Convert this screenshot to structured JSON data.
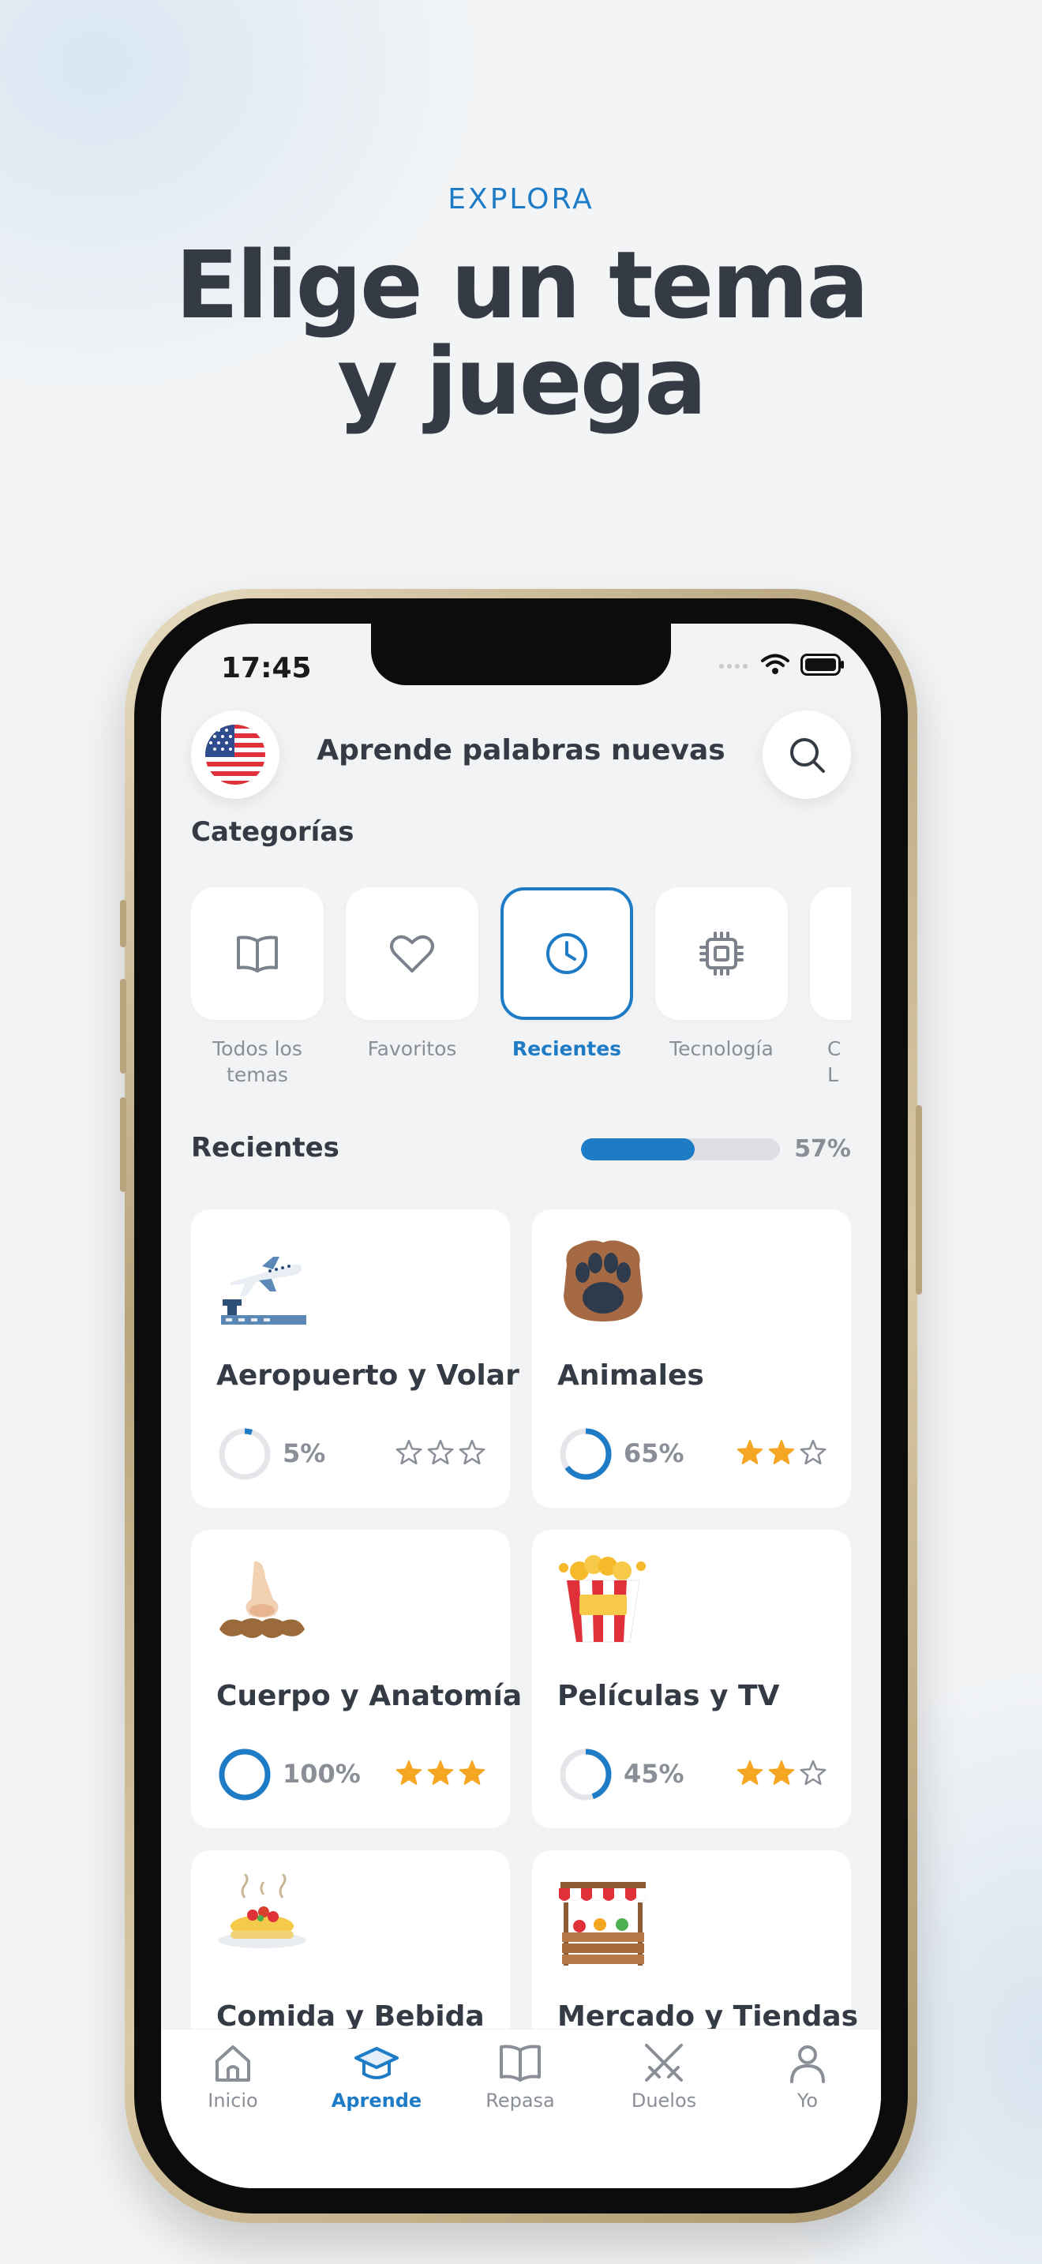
{
  "promo": {
    "kicker": "EXPLORA",
    "headline_line1": "Elige un tema",
    "headline_line2": "y juega"
  },
  "status_bar": {
    "time": "17:45"
  },
  "header": {
    "title": "Aprende palabras nuevas",
    "flag_icon": "us-flag-icon",
    "search_icon": "search-icon"
  },
  "categories": {
    "title": "Categorías",
    "items": [
      {
        "label": "Todos los temas",
        "icon": "book-icon",
        "active": false
      },
      {
        "label": "Favoritos",
        "icon": "heart-icon",
        "active": false
      },
      {
        "label": "Recientes",
        "icon": "clock-icon",
        "active": true
      },
      {
        "label": "Tecnología",
        "icon": "chip-icon",
        "active": false
      },
      {
        "label": "C L",
        "icon": "",
        "active": false
      }
    ]
  },
  "recent": {
    "title": "Recientes",
    "progress": 0.57,
    "progress_label": "57%"
  },
  "topics": [
    {
      "title": "Aeropuerto y Volar",
      "icon": "airplane-icon",
      "progress": 0.05,
      "pct_label": "5%",
      "stars": 0
    },
    {
      "title": "Animales",
      "icon": "paw-icon",
      "progress": 0.65,
      "pct_label": "65%",
      "stars": 2
    },
    {
      "title": "Cuerpo y Anatomía",
      "icon": "nose-icon",
      "progress": 1.0,
      "pct_label": "100%",
      "stars": 3
    },
    {
      "title": "Películas y TV",
      "icon": "popcorn-icon",
      "progress": 0.45,
      "pct_label": "45%",
      "stars": 2
    },
    {
      "title": "Comida y Bebida",
      "icon": "food-icon",
      "progress": null,
      "pct_label": "",
      "stars": null
    },
    {
      "title": "Mercado y Tiendas",
      "icon": "market-stall-icon",
      "progress": null,
      "pct_label": "",
      "stars": null
    }
  ],
  "tabbar": {
    "items": [
      {
        "label": "Inicio",
        "icon": "home-icon",
        "active": false
      },
      {
        "label": "Aprende",
        "icon": "graduation-cap-icon",
        "active": true
      },
      {
        "label": "Repasa",
        "icon": "open-book-icon",
        "active": false
      },
      {
        "label": "Duelos",
        "icon": "crossed-swords-icon",
        "active": false
      },
      {
        "label": "Yo",
        "icon": "person-icon",
        "active": false
      }
    ]
  },
  "colors": {
    "accent": "#1e7bc6",
    "star": "#f5a623",
    "muted": "#8a8f97",
    "text": "#353b45"
  }
}
